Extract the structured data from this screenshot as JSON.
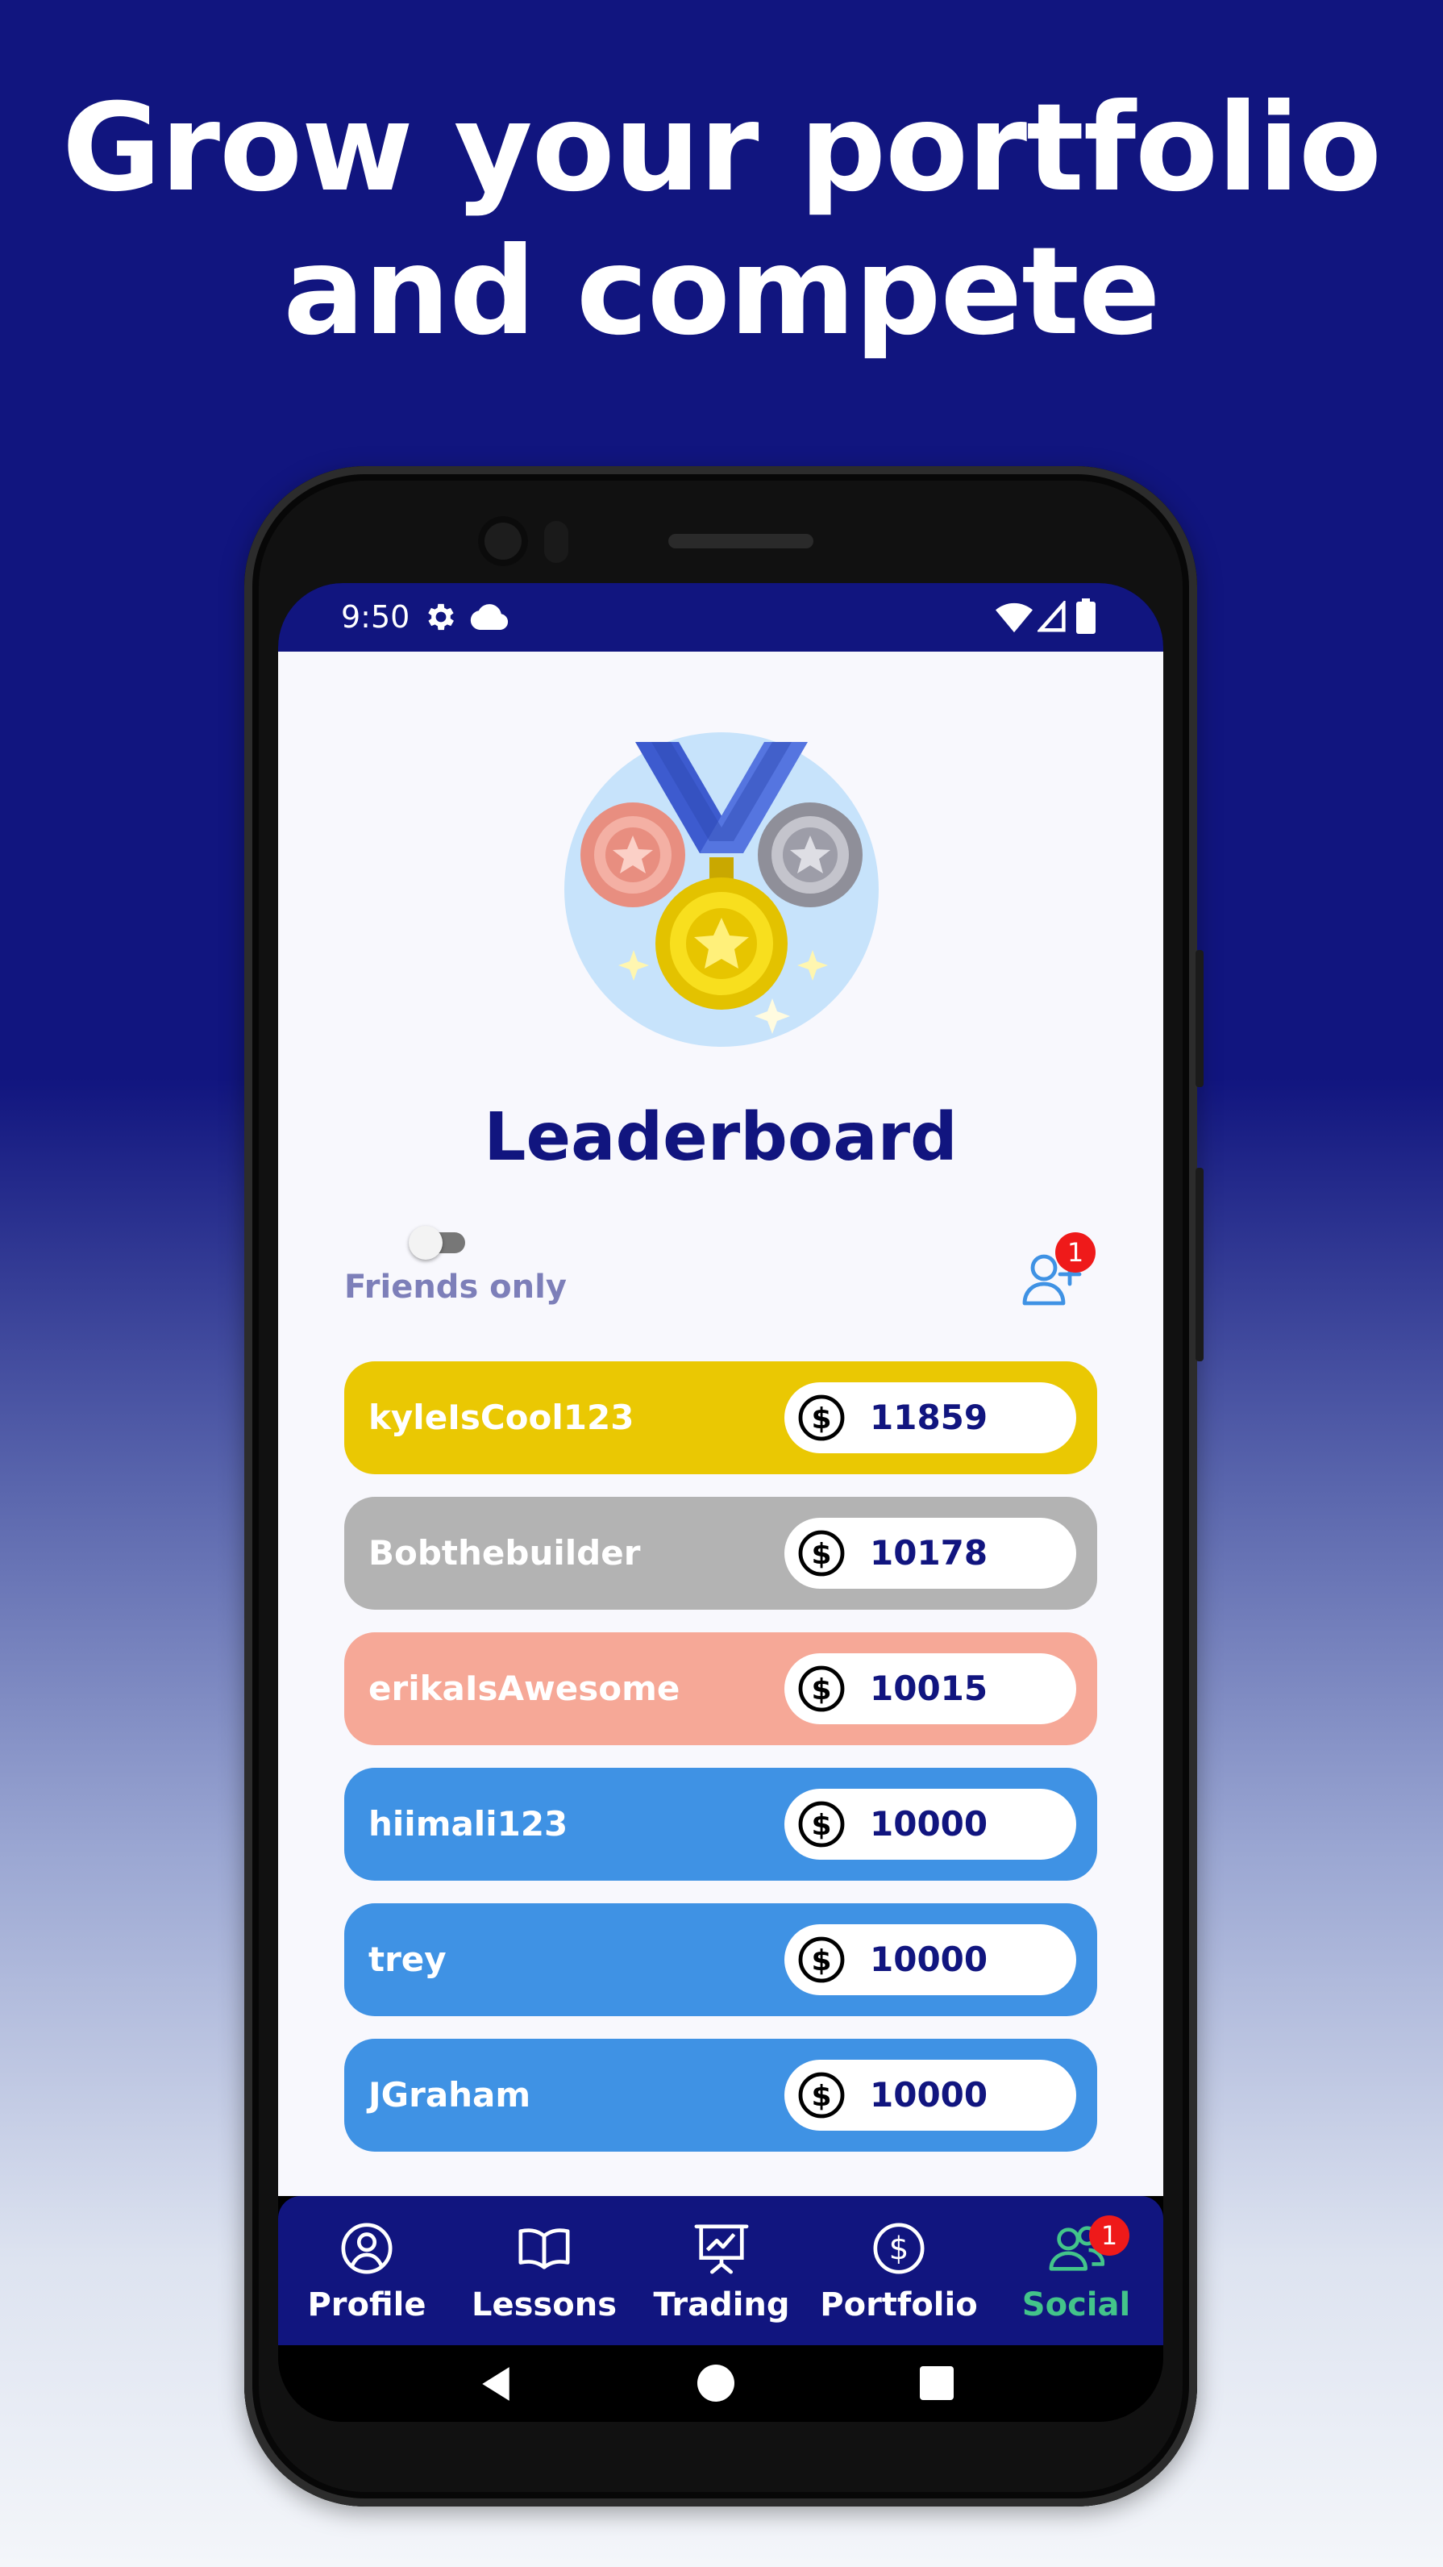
{
  "headline": {
    "line1": "Grow your portfolio",
    "line2": "and compete"
  },
  "status_bar": {
    "time": "9:50",
    "icons": [
      "gear-icon",
      "cloud-icon",
      "wifi-icon",
      "signal-icon",
      "battery-icon"
    ]
  },
  "leaderboard": {
    "title": "Leaderboard",
    "friends_toggle": {
      "label": "Friends only",
      "on": false
    },
    "add_friend_badge": "1",
    "rows": [
      {
        "name": "kyleIsCool123",
        "score": "11859",
        "color": "#eac803"
      },
      {
        "name": "Bobthebuilder",
        "score": "10178",
        "color": "#b3b3b3"
      },
      {
        "name": "erikaIsAwesome",
        "score": "10015",
        "color": "#f6a897"
      },
      {
        "name": "hiimali123",
        "score": "10000",
        "color": "#3f92e4"
      },
      {
        "name": "trey",
        "score": "10000",
        "color": "#3f92e4"
      },
      {
        "name": "JGraham",
        "score": "10000",
        "color": "#3f92e4"
      }
    ]
  },
  "bottom_nav": {
    "items": [
      {
        "label": "Profile",
        "icon": "profile-icon"
      },
      {
        "label": "Lessons",
        "icon": "book-icon"
      },
      {
        "label": "Trading",
        "icon": "chart-board-icon"
      },
      {
        "label": "Portfolio",
        "icon": "dollar-icon"
      },
      {
        "label": "Social",
        "icon": "users-icon",
        "badge": "1",
        "active": true
      }
    ]
  },
  "colors": {
    "brand_navy": "#11157f",
    "gold": "#eac803",
    "silver": "#b3b3b3",
    "bronze": "#f6a897",
    "blue": "#3f92e4",
    "active_nav": "#43c48a",
    "badge_red": "#ef1a1a"
  }
}
